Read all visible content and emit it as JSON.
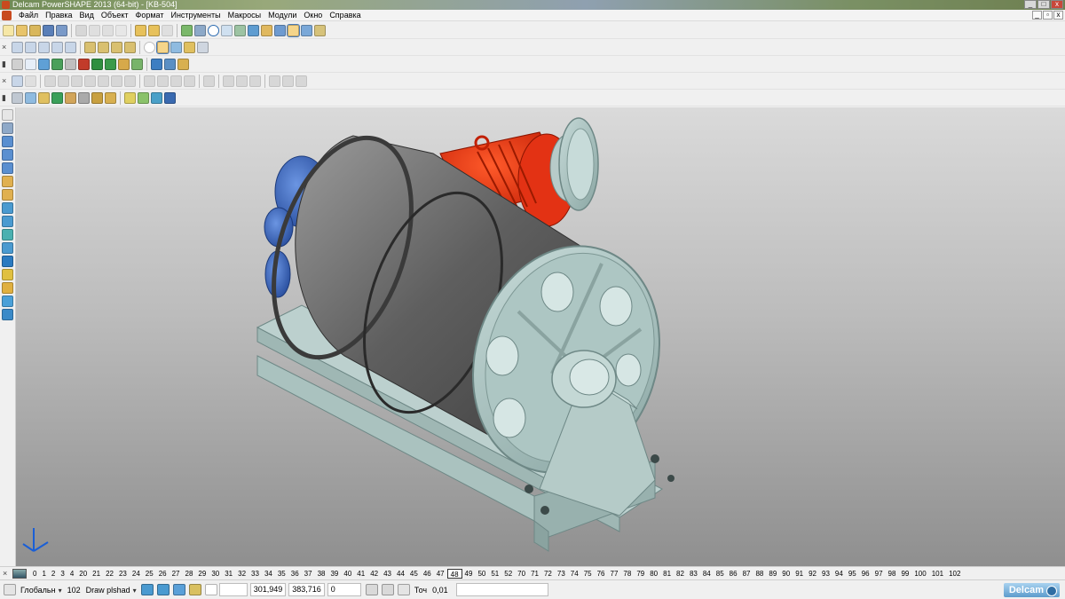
{
  "window": {
    "title": "Delcam PowerSHAPE 2013 (64-bit) - [KB-504]"
  },
  "menu": [
    "Файл",
    "Правка",
    "Вид",
    "Объект",
    "Формат",
    "Инструменты",
    "Макросы",
    "Модули",
    "Окно",
    "Справка"
  ],
  "levels": {
    "items": [
      "0",
      "1",
      "2",
      "3",
      "4",
      "20",
      "21",
      "22",
      "23",
      "24",
      "25",
      "26",
      "27",
      "28",
      "29",
      "30",
      "31",
      "32",
      "33",
      "34",
      "35",
      "36",
      "37",
      "38",
      "39",
      "40",
      "41",
      "42",
      "43",
      "44",
      "45",
      "46",
      "47",
      "48",
      "49",
      "50",
      "51",
      "52",
      "70",
      "71",
      "72",
      "73",
      "74",
      "75",
      "76",
      "77",
      "78",
      "79",
      "80",
      "81",
      "82",
      "83",
      "84",
      "85",
      "86",
      "87",
      "88",
      "89",
      "90",
      "91",
      "92",
      "93",
      "94",
      "95",
      "96",
      "97",
      "98",
      "99",
      "100",
      "101",
      "102"
    ],
    "current": "48"
  },
  "status": {
    "workplane": "Глобальн",
    "number": "102",
    "draw_mode": "Draw plshad",
    "coord_x": "301,949",
    "coord_y": "383,716",
    "coord_z": "0",
    "tolerance_label": "Точ",
    "tolerance_value": "0,01",
    "brand": "Delcam"
  },
  "icons": {
    "top_toolbar_1": [
      "new-file-icon",
      "open-file-icon",
      "open-recent-icon",
      "save-icon",
      "save-as-icon",
      "print-icon",
      "cut-icon",
      "copy-icon",
      "paste-icon",
      "delete-icon",
      "undo-icon",
      "redo-icon",
      "repeat-icon",
      "line-icon",
      "arc-icon",
      "circle-icon",
      "curve-icon",
      "surface-icon",
      "solid-icon",
      "shaded-icon",
      "wireframe-icon",
      "magic-wand-icon"
    ],
    "colors": {
      "viewport_top": "#dadada",
      "viewport_bottom": "#8f8f8f",
      "drum": "#6f6f6f",
      "motor_red": "#e33214",
      "gearbox_blue": "#3e6cc4",
      "frame_steel": "#a9c2bf"
    }
  }
}
